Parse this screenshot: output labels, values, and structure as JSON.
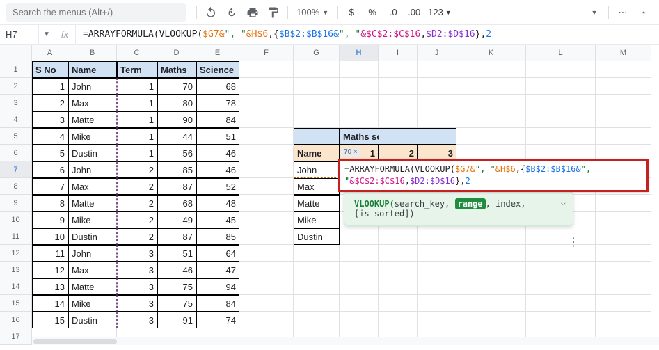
{
  "toolbar": {
    "search_placeholder": "Search the menus (Alt+/)",
    "zoom": "100%",
    "currency": "$",
    "percent": "%",
    "dec_dec": ".0",
    "dec_inc": ".00",
    "num_fmt": "123"
  },
  "formula_bar": {
    "cell_ref": "H7",
    "fx": "fx",
    "prefix": "=ARRAYFORMULA(VLOOKUP(",
    "g7": "$G7",
    "amp": "&",
    "q1": "\", \"",
    "h6": "&H$6",
    "comma": ",",
    "brace_o": "{",
    "b_range": "$B$2:$B$16",
    "c_range": "&$C$2:$C$16",
    "d_range": "$D2:$D$16",
    "brace_c": "}",
    "two": "2"
  },
  "columns": [
    "A",
    "B",
    "C",
    "D",
    "E",
    "F",
    "G",
    "H",
    "I",
    "J",
    "K",
    "L",
    "M"
  ],
  "headers": {
    "a": "S No",
    "b": "Name",
    "c": "Term",
    "d": "Maths",
    "e": "Science"
  },
  "table": [
    {
      "n": "1",
      "name": "John",
      "term": "1",
      "m": "70",
      "s": "68"
    },
    {
      "n": "2",
      "name": "Max",
      "term": "1",
      "m": "80",
      "s": "78"
    },
    {
      "n": "3",
      "name": "Matte",
      "term": "1",
      "m": "90",
      "s": "84"
    },
    {
      "n": "4",
      "name": "Mike",
      "term": "1",
      "m": "44",
      "s": "51"
    },
    {
      "n": "5",
      "name": "Dustin",
      "term": "1",
      "m": "56",
      "s": "46"
    },
    {
      "n": "6",
      "name": "John",
      "term": "2",
      "m": "85",
      "s": "46"
    },
    {
      "n": "7",
      "name": "Max",
      "term": "2",
      "m": "87",
      "s": "52"
    },
    {
      "n": "8",
      "name": "Matte",
      "term": "2",
      "m": "68",
      "s": "48"
    },
    {
      "n": "9",
      "name": "Mike",
      "term": "2",
      "m": "49",
      "s": "45"
    },
    {
      "n": "10",
      "name": "Dustin",
      "term": "2",
      "m": "87",
      "s": "85"
    },
    {
      "n": "11",
      "name": "John",
      "term": "3",
      "m": "51",
      "s": "64"
    },
    {
      "n": "12",
      "name": "Max",
      "term": "3",
      "m": "46",
      "s": "47"
    },
    {
      "n": "13",
      "name": "Matte",
      "term": "3",
      "m": "75",
      "s": "94"
    },
    {
      "n": "14",
      "name": "Mike",
      "term": "3",
      "m": "75",
      "s": "84"
    },
    {
      "n": "15",
      "name": "Dustin",
      "term": "3",
      "m": "91",
      "s": "74"
    }
  ],
  "side": {
    "title": "Maths scores",
    "name_h": "Name",
    "c1": "1",
    "c2": "2",
    "c3": "3",
    "names": [
      "John",
      "Max",
      "Matte",
      "Mike",
      "Dustin"
    ]
  },
  "chip": "70 ×",
  "overlay": {
    "p1": "=ARRAYFORMULA(",
    "p2": "VLOOKUP(",
    "g": "$G7",
    "amp": "&",
    "q": "\", \"",
    "h": "&H$6",
    "c": ",",
    "bo": "{",
    "br": "$B$2:$B$16",
    "cr": "&$C$2:$C$16",
    "dr": "$D2:$D$16",
    "bc": "}",
    "two": "2"
  },
  "help": {
    "fn": "VLOOKUP(",
    "a1": "search_key",
    "a2": "range",
    "a3": "index",
    "a4": "[is_sorted]",
    "close": ")"
  }
}
